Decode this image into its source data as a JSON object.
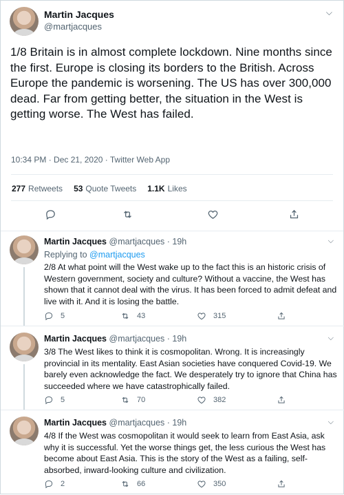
{
  "main": {
    "name": "Martin Jacques",
    "handle": "@martjacques",
    "text": "1/8 Britain is in almost complete lockdown. Nine months since the first. Europe is closing its borders to the British. Across Europe the pandemic is worsening. The US has over 300,000 dead. Far from getting better, the situation in the West is getting worse. The West has failed.",
    "meta": "10:34 PM · Dec 21, 2020 · Twitter Web App",
    "retweets_count": "277",
    "retweets_label": "Retweets",
    "quotes_count": "53",
    "quotes_label": "Quote Tweets",
    "likes_count": "1.1K",
    "likes_label": "Likes"
  },
  "replies": [
    {
      "name": "Martin Jacques",
      "handle": "@martjacques",
      "time": "19h",
      "replying_prefix": "Replying to",
      "replying_to": "@martjacques",
      "text": "2/8 At what point will the West wake up to the fact this is an historic crisis of Western government, society and culture? Without a vaccine, the West has shown that it cannot deal with the virus. It has been forced to admit defeat and live with it. And it is losing the battle.",
      "reply_count": "5",
      "retweet_count": "43",
      "like_count": "315"
    },
    {
      "name": "Martin Jacques",
      "handle": "@martjacques",
      "time": "19h",
      "text": "3/8 The West likes to think it is cosmopolitan. Wrong. It is increasingly provincial in its mentality. East Asian societies have conquered Covid-19. We barely even acknowledge the fact. We desperately try to ignore that China has succeeded where we have catastrophically failed.",
      "reply_count": "5",
      "retweet_count": "70",
      "like_count": "382"
    },
    {
      "name": "Martin Jacques",
      "handle": "@martjacques",
      "time": "19h",
      "text": "4/8 If the West was cosmopolitan it would seek to learn from East Asia, ask why it is successful. Yet the worse things get, the less curious the West has become about East Asia. This is the story of the West as a failing, self-absorbed, inward-looking culture and civilization.",
      "reply_count": "2",
      "retweet_count": "66",
      "like_count": "350"
    }
  ],
  "icons": [
    "reply-icon",
    "retweet-icon",
    "like-icon",
    "share-icon",
    "more-icon"
  ],
  "colors": {
    "link": "#1d9bf0",
    "muted": "#536471",
    "text": "#0f1419",
    "border": "#e6ecf0"
  }
}
